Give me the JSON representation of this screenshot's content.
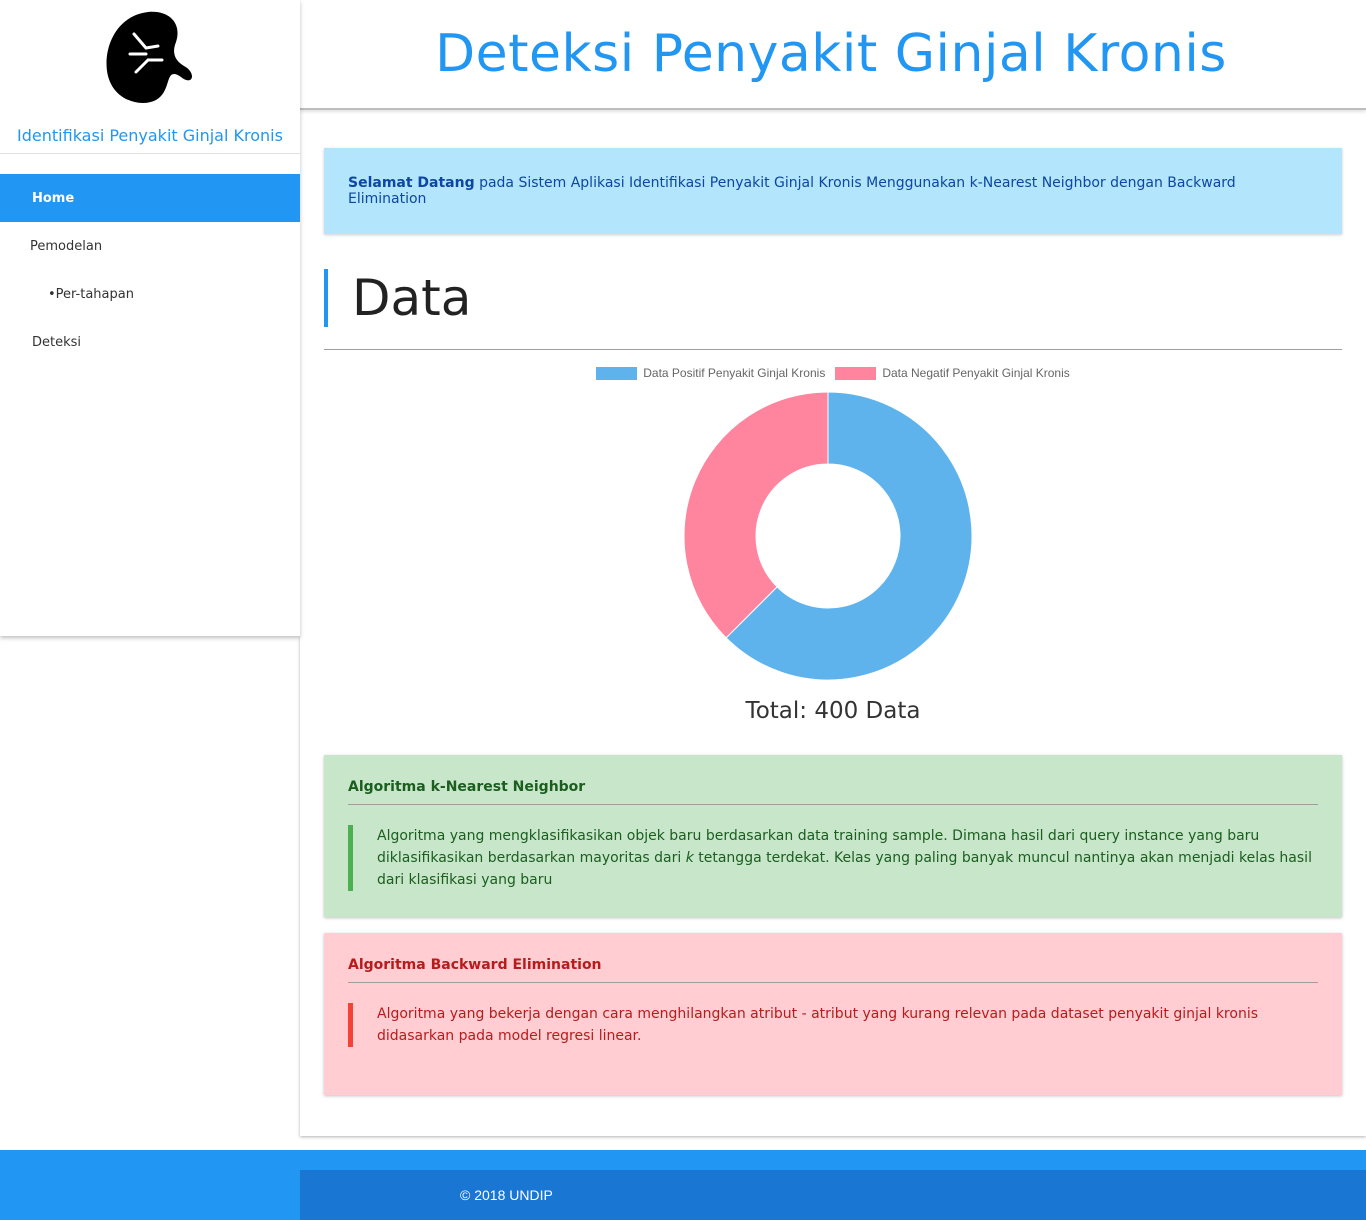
{
  "sidebar": {
    "logo_icon": "kidney-icon",
    "title": "Identifikasi Penyakit Ginjal Kronis",
    "items": [
      {
        "label": "Home",
        "active": true
      },
      {
        "label": "Pemodelan"
      },
      {
        "label": "•Per-tahapan"
      },
      {
        "label": "Deteksi"
      }
    ]
  },
  "header": {
    "title": "Deteksi Penyakit Ginjal Kronis"
  },
  "welcome": {
    "bold": "Selamat Datang",
    "text": " pada Sistem Aplikasi Identifikasi Penyakit Ginjal Kronis Menggunakan k-Nearest Neighbor dengan Backward Elimination"
  },
  "section": {
    "title": "Data"
  },
  "chart_data": {
    "type": "pie",
    "donut": true,
    "categories": [
      "Data Positif Penyakit Ginjal Kronis",
      "Data Negatif Penyakit Ginjal Kronis"
    ],
    "values": [
      250,
      150
    ],
    "colors": [
      "#5fb3ed",
      "#ff849e"
    ],
    "legend": "top",
    "total_label": "Total: 400 Data"
  },
  "knn": {
    "title": "Algoritma k-Nearest Neighbor",
    "text_before_k": "Algoritma yang mengklasifikasikan objek baru berdasarkan data training sample. Dimana hasil dari query instance yang baru diklasifikasikan berdasarkan mayoritas dari ",
    "k": "k",
    "text_after_k": " tetangga terdekat. Kelas yang paling banyak muncul nantinya akan menjadi kelas hasil dari klasifikasi yang baru"
  },
  "be": {
    "title": "Algoritma Backward Elimination",
    "text": "Algoritma yang bekerja dengan cara menghilangkan atribut - atribut yang kurang relevan pada dataset penyakit ginjal kronis didasarkan pada model regresi linear."
  },
  "footer": {
    "text": "© 2018 UNDIP"
  }
}
